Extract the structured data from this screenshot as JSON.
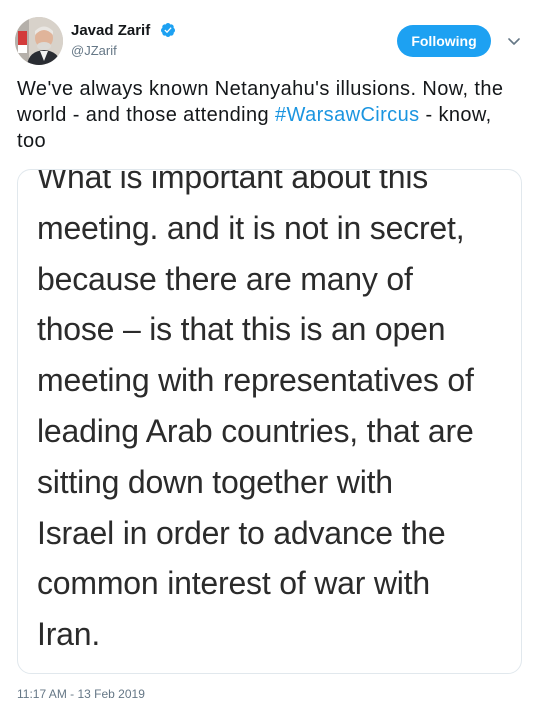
{
  "user": {
    "display_name": "Javad Zarif",
    "handle": "@JZarif",
    "verified": true,
    "avatar_icon": "profile-photo"
  },
  "follow_button": {
    "label": "Following",
    "color": "#1da1f2"
  },
  "tweet": {
    "text_before": "We've always known Netanyahu's illusions. Now, the world - and those attending ",
    "hashtag": "#WarsawCircus",
    "text_after": " - know, too",
    "hashtag_color": "#1b95e0"
  },
  "media": {
    "lines": [
      "What is important about this",
      "meeting. and it is not in secret,",
      "because there are many of",
      "those – is that this is an open",
      "meeting with representatives of",
      "leading Arab countries, that are",
      "sitting down together with",
      "Israel in order to advance the",
      "common interest of war with",
      "Iran."
    ]
  },
  "timestamp": "11:17 AM - 13 Feb 2019",
  "icons": {
    "verified": "verified-badge-icon",
    "more": "chevron-down-icon"
  }
}
